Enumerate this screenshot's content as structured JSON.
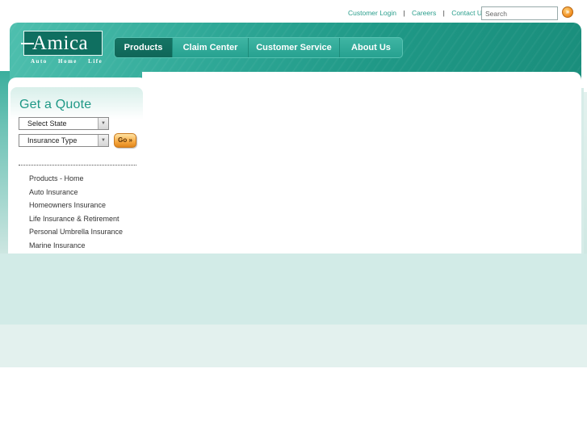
{
  "utility": {
    "links": [
      "Customer Login",
      "Careers",
      "Contact Us"
    ],
    "search_placeholder": "Search",
    "search_go": "»"
  },
  "logo": {
    "name": "Amica",
    "taglines": [
      "Auto",
      "Home",
      "Life"
    ]
  },
  "nav": {
    "items": [
      "Products",
      "Claim Center",
      "Customer Service",
      "About Us"
    ],
    "active": "Products"
  },
  "quote": {
    "title": "Get a Quote",
    "state_select": "Select State",
    "type_select": "Insurance Type",
    "go_label": "Go »"
  },
  "products": {
    "items": [
      "Products - Home",
      "Auto Insurance",
      "Homeowners Insurance",
      "Life Insurance & Retirement",
      "Personal Umbrella Insurance",
      "Marine Insurance"
    ]
  },
  "colors": {
    "brand_teal": "#1f9886",
    "dark_teal": "#0f6f60",
    "accent_orange": "#f08a1c",
    "link_teal": "#2a9e8c"
  }
}
